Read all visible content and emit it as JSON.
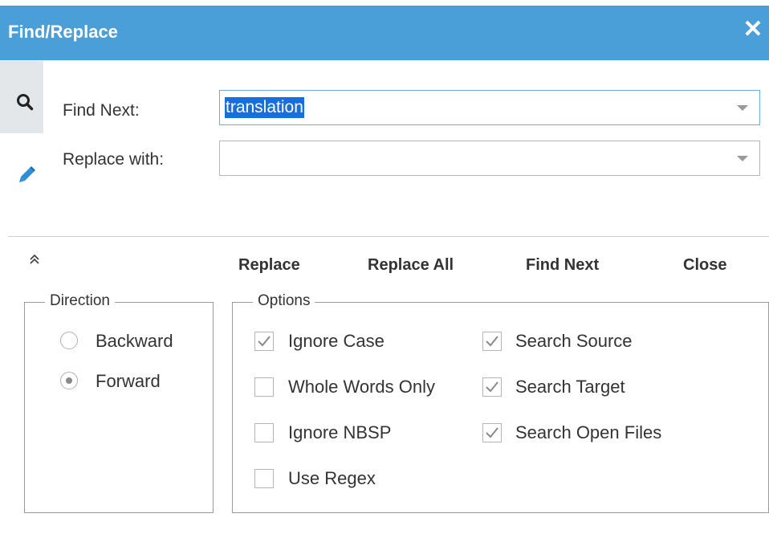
{
  "dialog": {
    "title": "Find/Replace",
    "close_glyph": "✕"
  },
  "side_tabs": [
    {
      "icon": "search-icon"
    },
    {
      "icon": "pencil-icon"
    }
  ],
  "find": {
    "label": "Find Next:",
    "value": "translation"
  },
  "replace": {
    "label": "Replace with:",
    "value": ""
  },
  "collapse_glyph": "≈",
  "buttons": {
    "replace": "Replace",
    "replace_all": "Replace All",
    "find_next": "Find Next",
    "close": "Close"
  },
  "direction": {
    "legend": "Direction",
    "options": [
      {
        "label": "Backward",
        "selected": false
      },
      {
        "label": "Forward",
        "selected": true
      }
    ]
  },
  "options": {
    "legend": "Options",
    "items": [
      {
        "label": "Ignore Case",
        "checked": true
      },
      {
        "label": "Whole Words Only",
        "checked": false
      },
      {
        "label": "Ignore NBSP",
        "checked": false
      },
      {
        "label": "Use Regex",
        "checked": false
      },
      {
        "label": "Search Source",
        "checked": true
      },
      {
        "label": "Search Target",
        "checked": true
      },
      {
        "label": "Search Open Files",
        "checked": true
      }
    ]
  },
  "colors": {
    "titlebar": "#4a9fd8",
    "selection": "#1a6ed8",
    "pencil": "#2f8ed8"
  }
}
